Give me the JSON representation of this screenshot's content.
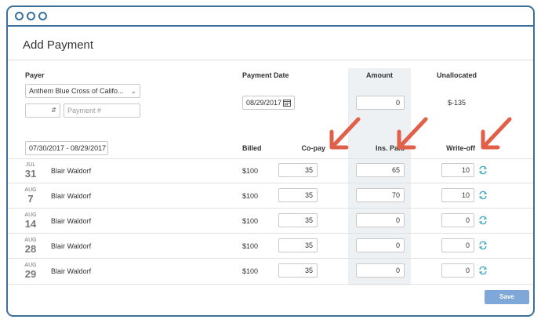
{
  "title": "Add Payment",
  "headers": {
    "payer": "Payer",
    "payment_date": "Payment Date",
    "amount": "Amount",
    "unallocated": "Unallocated",
    "billed": "Billed",
    "copay": "Co-pay",
    "ins_paid": "Ins. Paid",
    "write_off": "Write-off"
  },
  "payer_select": "Anthem Blue Cross of Califo...",
  "small_select": "",
  "payment_number_placeholder": "Payment #",
  "payment_date": "08/29/2017",
  "amount": "0",
  "unallocated": "$-135",
  "date_range": "07/30/2017 - 08/29/2017",
  "rows": [
    {
      "month": "JUL",
      "day": "31",
      "name": "Blair Waldorf",
      "billed": "$100",
      "copay": "35",
      "ins_paid": "65",
      "write_off": "10"
    },
    {
      "month": "AUG",
      "day": "7",
      "name": "Blair Waldorf",
      "billed": "$100",
      "copay": "35",
      "ins_paid": "70",
      "write_off": "10"
    },
    {
      "month": "AUG",
      "day": "14",
      "name": "Blair Waldorf",
      "billed": "$100",
      "copay": "35",
      "ins_paid": "0",
      "write_off": "0"
    },
    {
      "month": "AUG",
      "day": "28",
      "name": "Blair Waldorf",
      "billed": "$100",
      "copay": "35",
      "ins_paid": "0",
      "write_off": "0"
    },
    {
      "month": "AUG",
      "day": "29",
      "name": "Blair Waldorf",
      "billed": "$100",
      "copay": "35",
      "ins_paid": "0",
      "write_off": "0"
    }
  ],
  "save_label": "Save",
  "colors": {
    "frame": "#3d6f9c",
    "accent_arrow": "#e0604a",
    "save_button": "#7fa8d8",
    "refresh_icon": "#3fa9c4",
    "amount_column": "#edf1f4"
  }
}
